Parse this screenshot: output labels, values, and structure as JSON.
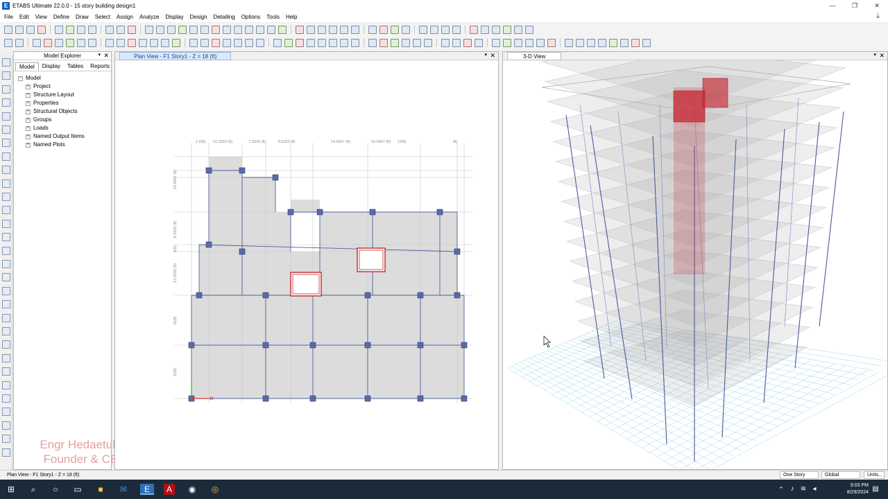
{
  "title_bar": {
    "app_title": "ETABS Ultimate 22.0.0 - 15 story building design1",
    "app_icon": "E"
  },
  "menu": [
    "File",
    "Edit",
    "View",
    "Define",
    "Draw",
    "Select",
    "Assign",
    "Analyze",
    "Display",
    "Design",
    "Detailing",
    "Options",
    "Tools",
    "Help"
  ],
  "model_explorer": {
    "title": "Model Explorer",
    "tabs": [
      "Model",
      "Display",
      "Tables",
      "Reports"
    ],
    "active_tab": "Model",
    "root": "Model",
    "items": [
      "Project",
      "Structure Layout",
      "Properties",
      "Structural Objects",
      "Groups",
      "Loads",
      "Named Output Items",
      "Named Plots"
    ]
  },
  "plan_view": {
    "title": "Plan View - F1 Story1 - Z = 18 (ft)",
    "top_dimensions": [
      "2.2(ft)",
      "10.3333 (ft)",
      "7.3333 (ft)",
      "9.6333 (ft)",
      "14.6667 (ft)",
      "10.6667 (ft)",
      "12(ft)",
      "(ft)"
    ],
    "left_dimensions": [
      "10.6667 (ft)",
      "9.3333 (ft)",
      "6(ft)",
      "13.3333 (ft)",
      "15(ft)",
      "15(ft)"
    ]
  },
  "view_3d": {
    "title": "3-D View"
  },
  "watermark": {
    "line1": "Engr Hedaetullah",
    "line2": "Founder & CEO"
  },
  "status_bar": {
    "text": "Plan View - F1 Story1 - Z = 18 (ft)",
    "story_mode": "One Story",
    "coord_system": "Global",
    "units": "Units..."
  },
  "taskbar": {
    "time": "9:03 PM",
    "date": "8/29/2024"
  },
  "colors": {
    "frame": "#4a5a9a",
    "slab": "#d8d8d8",
    "opening": "#c0282d",
    "accent": "#1560bd"
  }
}
